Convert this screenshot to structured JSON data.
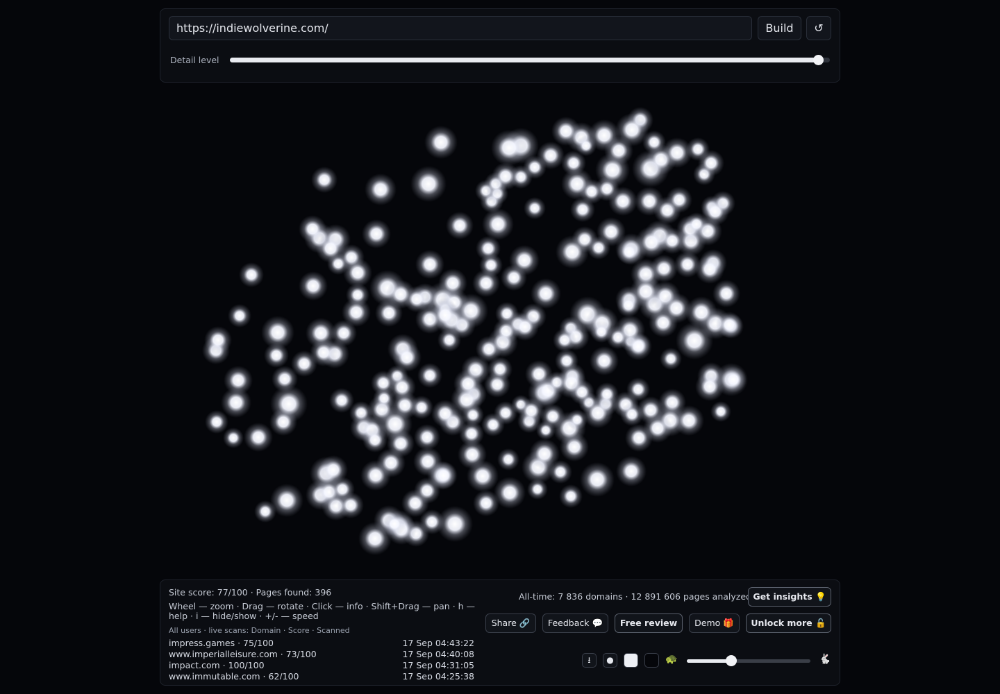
{
  "toolbar": {
    "url_value": "https://indiewolverine.com/",
    "build_label": "Build",
    "refresh_icon": "↺",
    "detail_label": "Detail level",
    "detail_value": 0.98
  },
  "stats": {
    "site_line": "Site score: 77/100 · Pages found: 396",
    "help_line1": "Wheel — zoom · Drag — rotate · Click — info · Shift+Drag — pan · h —",
    "help_line2": "help · i — hide/show · +/- — speed",
    "all_time": "All-time: 7 836 domains · 12 891 606 pages analyzed",
    "scans_header": "All users · live scans: Domain · Score · Scanned"
  },
  "scans": [
    {
      "domain": "impress.games · 75/100",
      "time": "17 Sep 04:43:22"
    },
    {
      "domain": "www.imperialleisure.com · 73/100",
      "time": "17 Sep 04:40:08"
    },
    {
      "domain": "impact.com · 100/100",
      "time": "17 Sep 04:31:05"
    },
    {
      "domain": "www.immutable.com · 62/100",
      "time": "17 Sep 04:25:38"
    }
  ],
  "actions": {
    "insights": "Get insights 💡",
    "share": "Share 🔗",
    "feedback": "Feedback 💬",
    "review": "Free review",
    "demo": "Demo 🎁",
    "unlock": "Unlock more 🔓"
  },
  "controls": {
    "slow_icon": "🐢",
    "fast_icon": "🐇",
    "speed_value": 0.36
  }
}
